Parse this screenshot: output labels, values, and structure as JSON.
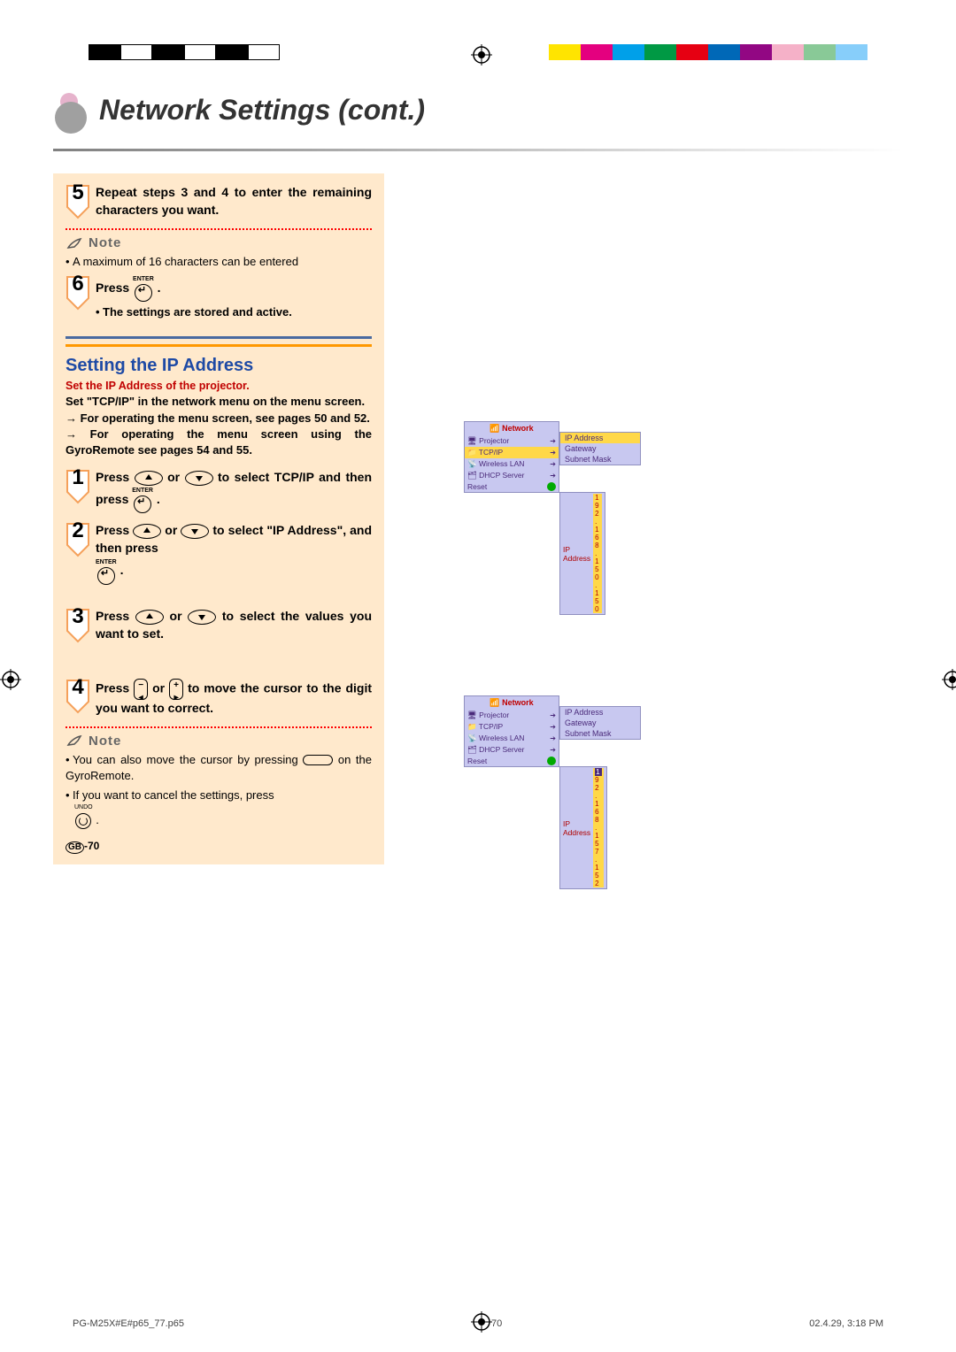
{
  "title": "Network Settings (cont.)",
  "steps_upper": {
    "s5": "Repeat steps 3 and 4 to enter the remaining characters you want.",
    "note_label": "Note",
    "note_5": "A maximum of 16 characters can be entered",
    "s6_a": "Press ",
    "s6_enter": "ENTER",
    "s6_b": ".",
    "s6_sub": "The settings are stored and active."
  },
  "section": {
    "heading": "Setting the IP Address",
    "redline": "Set the IP Address of the projector.",
    "para1": "Set \"TCP/IP\" in the network menu on the menu screen.",
    "para2a": "→ For operating the menu screen, see pages 50 and 52.",
    "para2b": "→ For operating the menu screen using the GyroRemote see pages 54 and 55."
  },
  "steps_lower": {
    "s1a": "Press ",
    "s1b": " or ",
    "s1c": " to select TCP/IP and then press ",
    "s1_enter": "ENTER",
    "s1d": " .",
    "s2a": "Press ",
    "s2b": " or ",
    "s2c": " to select \"IP Address\", and then press",
    "s2_enter": "ENTER",
    "s2d": ".",
    "s3a": "Press ",
    "s3b": " or ",
    "s3c": " to select the values you want to set.",
    "s4a": "Press ",
    "s4b": " or ",
    "s4c": " to move the cursor to the digit you want to correct.",
    "note_label": "Note",
    "note4a": "You can also move the cursor by pressing ",
    "note4a2": " on the GyroRemote.",
    "note4b": "If you want to cancel the settings, press ",
    "note4_undo": "UNDO",
    "note4b2": "."
  },
  "menus": {
    "title": "Network",
    "items": [
      "Projector",
      "TCP/IP",
      "Wireless LAN",
      "DHCP Server",
      "Reset"
    ],
    "submenu": [
      "IP Address",
      "Gateway",
      "Subnet Mask"
    ],
    "ip_label": "IP Address",
    "ip1": "1 9 2 . 1 6 8 . 1 5 0 . 1 5 0",
    "ip2": "9 2 . 1 6 8 . 1 5 7 . 1 5 2",
    "ip2_cursor": "1"
  },
  "footer": {
    "file": "PG-M25X#E#p65_77.p65",
    "page": "70",
    "time": "02.4.29, 3:18 PM",
    "gb": "GB",
    "num": "-70"
  },
  "colors": {
    "bar": [
      "#000000",
      "#ffffff",
      "#000000",
      "#ffffff",
      "#000000",
      "#ffffff"
    ],
    "cmyk": [
      "#ffe400",
      "#e4007f",
      "#00a0e9",
      "#009944",
      "#e60012",
      "#0068b7",
      "#920783",
      "#f5b1c8",
      "#89c997",
      "#87cefa"
    ]
  }
}
